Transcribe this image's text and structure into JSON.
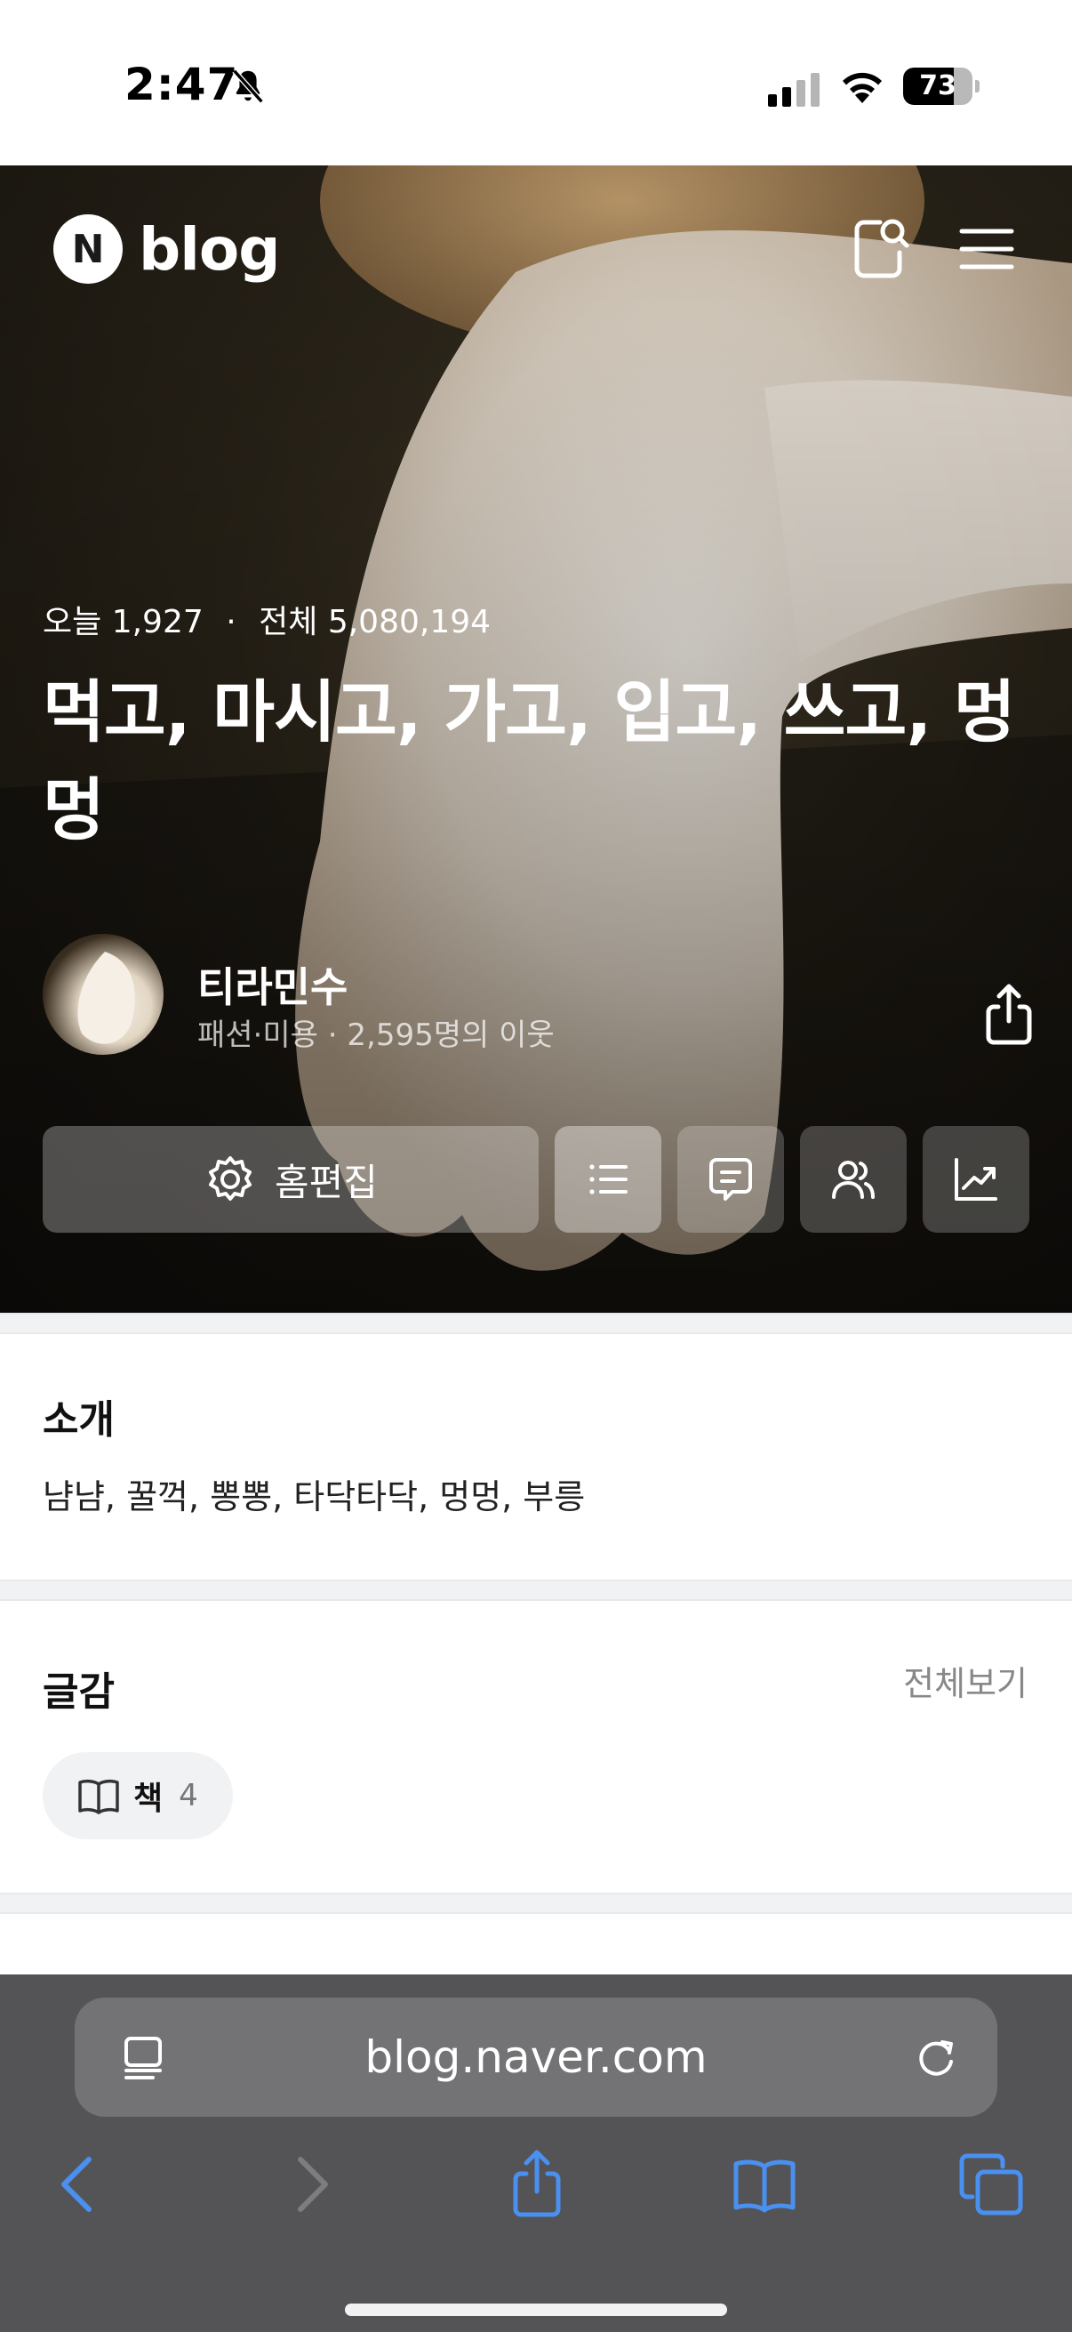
{
  "status_bar": {
    "time": "2:47",
    "battery": 73,
    "icons": [
      "bell-slash-icon",
      "signal-icon",
      "wifi-icon",
      "battery-icon"
    ]
  },
  "header": {
    "brand_letter": "N",
    "brand_text": "blog",
    "icons": [
      "search-icon",
      "menu-icon"
    ]
  },
  "stats": {
    "today_label": "오늘",
    "today_value": "1,927",
    "separator": "·",
    "total_label": "전체",
    "total_value": "5,080,194"
  },
  "blog": {
    "title": "먹고, 마시고, 가고, 입고, 쓰고, 멍멍"
  },
  "owner": {
    "name": "티라민수",
    "category": "패션·미용",
    "meta_sep": "·",
    "neighbors": "2,595명의 이웃"
  },
  "actions": {
    "edit_label": "홈편집",
    "icons": [
      "gear-icon",
      "list-icon",
      "comment-icon",
      "neighbors-icon",
      "stats-icon",
      "share-icon"
    ]
  },
  "intro": {
    "heading": "소개",
    "text": "냠냠, 꿀꺽, 뽕뽕, 타닥타닥, 멍멍, 부릉"
  },
  "topics": {
    "heading": "글감",
    "see_all": "전체보기",
    "chip_label": "책",
    "chip_count": "4"
  },
  "browser": {
    "url": "blog.naver.com",
    "icons": [
      "reader-icon",
      "reload-icon",
      "back-icon",
      "forward-icon",
      "share-icon",
      "bookmarks-icon",
      "tabs-icon"
    ]
  },
  "colors": {
    "accent_blue": "#4a90f0",
    "toolbar_bg": "#545456",
    "urlbar_bg": "#737375",
    "divider": "#f1f2f4"
  }
}
